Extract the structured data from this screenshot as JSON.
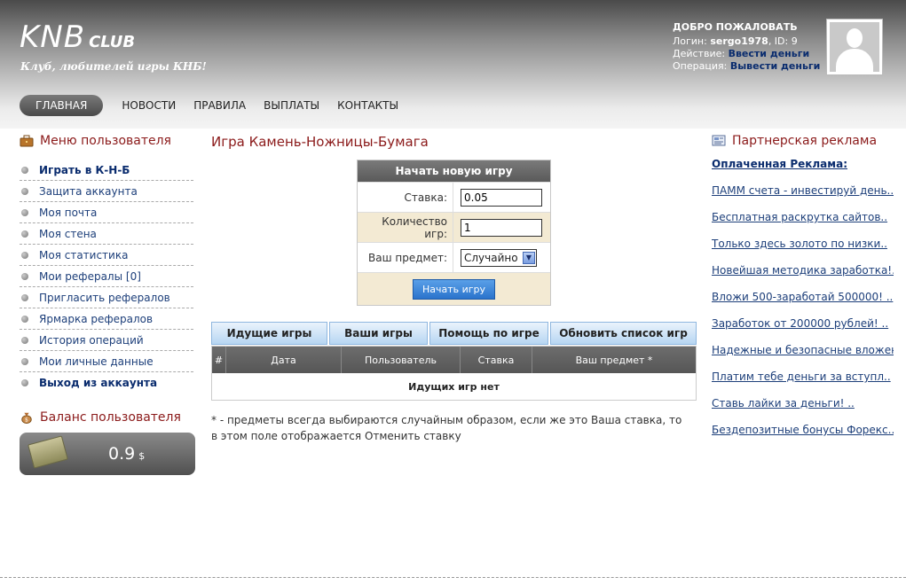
{
  "header": {
    "logo_main": "KNB",
    "logo_sub": "CLUB",
    "tagline": "Клуб, любителей игры КНБ!",
    "welcome_title": "ДОБРО ПОЖАЛОВАТЬ",
    "login_label": "Логин:",
    "login_value": "sergo1978",
    "id_text": ", ID: 9",
    "action_label": "Действие:",
    "action_link": "Ввести деньги",
    "operation_label": "Операция:",
    "operation_link": "Вывести деньги"
  },
  "nav": {
    "items": [
      {
        "label": "ГЛАВНАЯ"
      },
      {
        "label": "НОВОСТИ"
      },
      {
        "label": "ПРАВИЛА"
      },
      {
        "label": "ВЫПЛАТЫ"
      },
      {
        "label": "КОНТАКТЫ"
      }
    ]
  },
  "left": {
    "menu_title": "Меню пользователя",
    "items": [
      {
        "label": "Играть в К-Н-Б"
      },
      {
        "label": "Защита аккаунта"
      },
      {
        "label": "Моя почта"
      },
      {
        "label": "Моя стена"
      },
      {
        "label": "Моя статистика"
      },
      {
        "label": "Мои рефералы [0]"
      },
      {
        "label": "Пригласить рефералов"
      },
      {
        "label": "Ярмарка рефералов"
      },
      {
        "label": "История операций"
      },
      {
        "label": "Мои личные данные"
      },
      {
        "label": "Выход из аккаунта"
      }
    ],
    "balance_title": "Баланс пользователя",
    "balance_value": "0.9",
    "balance_currency": "$"
  },
  "main": {
    "title": "Игра Камень-Ножницы-Бумага",
    "newgame": {
      "header": "Начать новую игру",
      "stake_label": "Ставка:",
      "stake_value": "0.05",
      "count_label": "Количество игр:",
      "count_value": "1",
      "item_label": "Ваш предмет:",
      "item_value": "Случайно",
      "submit": "Начать игру"
    },
    "tabs": [
      {
        "label": "Идущие игры"
      },
      {
        "label": "Ваши игры"
      },
      {
        "label": "Помощь по игре"
      },
      {
        "label": "Обновить список игр"
      }
    ],
    "columns": [
      "#",
      "Дата",
      "Пользователь",
      "Ставка",
      "Ваш предмет *"
    ],
    "empty": "Идущих игр нет",
    "note": "* - предметы всегда выбираются случайным образом, если же это Ваша ставка, то в этом поле отображается Отменить ставку"
  },
  "right": {
    "title": "Партнерская реклама",
    "paid": "Оплаченная Реклама:",
    "ads": [
      {
        "label": "ПАММ счета - инвестируй день.."
      },
      {
        "label": "Бесплатная раскрутка сайтов.."
      },
      {
        "label": "Только здесь золото по низки.."
      },
      {
        "label": "Новейшая методика заработка!.."
      },
      {
        "label": "Вложи 500-заработай 500000! .."
      },
      {
        "label": "Заработок от 200000 рублей! .."
      },
      {
        "label": "Надежные и безопасные вложен.."
      },
      {
        "label": "Платим тебе деньги за вступл.."
      },
      {
        "label": "Ставь лайки за деньги! .."
      },
      {
        "label": "Бездепозитные бонусы Форекс.."
      }
    ]
  }
}
